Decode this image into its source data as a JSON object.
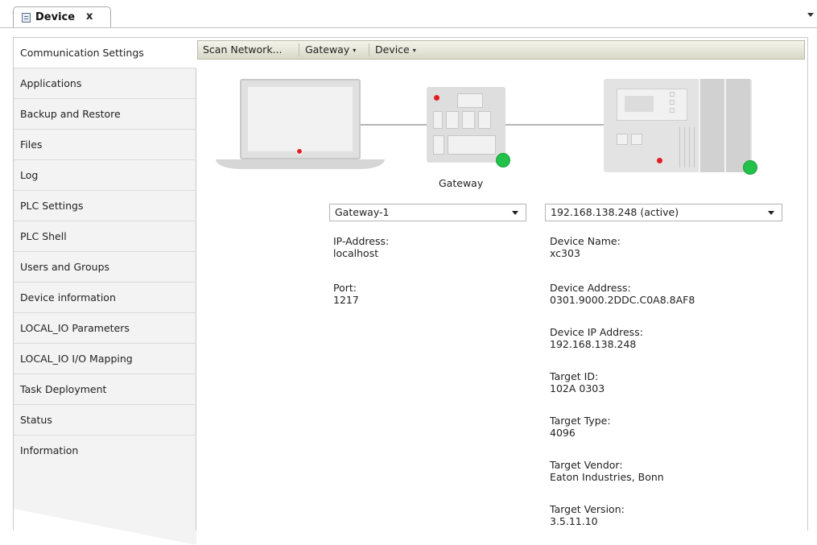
{
  "tab": {
    "title": "Device",
    "close": "x"
  },
  "nav": {
    "items": [
      {
        "label": "Communication Settings",
        "active": true
      },
      {
        "label": "Applications"
      },
      {
        "label": "Backup and Restore"
      },
      {
        "label": "Files"
      },
      {
        "label": "Log"
      },
      {
        "label": "PLC Settings"
      },
      {
        "label": "PLC Shell"
      },
      {
        "label": "Users and Groups"
      },
      {
        "label": "Device information"
      },
      {
        "label": "LOCAL_IO Parameters"
      },
      {
        "label": "LOCAL_IO I/O Mapping"
      },
      {
        "label": "Task Deployment"
      },
      {
        "label": "Status"
      },
      {
        "label": "Information"
      }
    ]
  },
  "toolbar": {
    "scan_network": "Scan Network...",
    "gateway": "Gateway",
    "device": "Device",
    "menu_arrow": "▾"
  },
  "topology": {
    "gateway_label": "Gateway",
    "status_color": "#22c14a",
    "led_color": "#e02020"
  },
  "gateway": {
    "selected": "Gateway-1",
    "fields": [
      {
        "label": "IP-Address:",
        "value": "localhost"
      },
      {
        "label": "Port:",
        "value": "1217"
      }
    ]
  },
  "device": {
    "selected": "192.168.138.248 (active)",
    "fields": [
      {
        "label": "Device Name:",
        "value": "xc303"
      },
      {
        "label": "Device Address:",
        "value": "0301.9000.2DDC.C0A8.8AF8"
      },
      {
        "label": "Device IP Address:",
        "value": "192.168.138.248"
      },
      {
        "label": "Target ID:",
        "value": "102A 0303"
      },
      {
        "label": "Target Type:",
        "value": "4096"
      },
      {
        "label": "Target Vendor:",
        "value": "Eaton Industries, Bonn"
      },
      {
        "label": "Target Version:",
        "value": "3.5.11.10"
      }
    ]
  }
}
